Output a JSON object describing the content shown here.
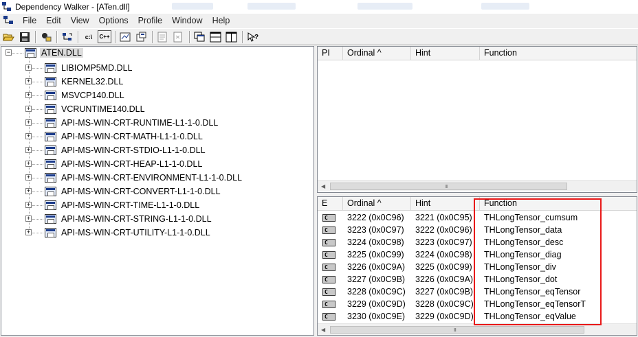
{
  "window": {
    "title": "Dependency Walker - [ATen.dll]"
  },
  "menu": [
    "File",
    "Edit",
    "View",
    "Options",
    "Profile",
    "Window",
    "Help"
  ],
  "toolbar": {
    "buttons": [
      {
        "name": "open-icon"
      },
      {
        "name": "save-icon"
      },
      {
        "name": "copy-icon"
      },
      {
        "name": "refresh-icon"
      },
      {
        "name": "full-paths-label",
        "label": "c:\\"
      },
      {
        "name": "undecorate-cpp-label",
        "label": "C++"
      },
      {
        "name": "auto-expand-icon"
      },
      {
        "name": "properties-icon"
      },
      {
        "name": "system-info-icon"
      },
      {
        "name": "find-icon"
      },
      {
        "name": "configure-paths-icon"
      },
      {
        "name": "module-list-icon"
      },
      {
        "name": "cascade-icon"
      },
      {
        "name": "tile-horizontal-icon"
      },
      {
        "name": "tile-vertical-icon"
      },
      {
        "name": "help-icon"
      }
    ]
  },
  "tree": {
    "root": "ATEN.DLL",
    "children": [
      "LIBIOMP5MD.DLL",
      "KERNEL32.DLL",
      "MSVCP140.DLL",
      "VCRUNTIME140.DLL",
      "API-MS-WIN-CRT-RUNTIME-L1-1-0.DLL",
      "API-MS-WIN-CRT-MATH-L1-1-0.DLL",
      "API-MS-WIN-CRT-STDIO-L1-1-0.DLL",
      "API-MS-WIN-CRT-HEAP-L1-1-0.DLL",
      "API-MS-WIN-CRT-ENVIRONMENT-L1-1-0.DLL",
      "API-MS-WIN-CRT-CONVERT-L1-1-0.DLL",
      "API-MS-WIN-CRT-TIME-L1-1-0.DLL",
      "API-MS-WIN-CRT-STRING-L1-1-0.DLL",
      "API-MS-WIN-CRT-UTILITY-L1-1-0.DLL"
    ]
  },
  "imports_pane": {
    "columns": [
      "PI",
      "Ordinal ^",
      "Hint",
      "Function"
    ]
  },
  "exports_pane": {
    "columns": [
      "E",
      "Ordinal ^",
      "Hint",
      "Function"
    ],
    "rows": [
      {
        "e": "C",
        "ordinal": "3222 (0x0C96)",
        "hint": "3221 (0x0C95)",
        "function": "THLongTensor_cumsum"
      },
      {
        "e": "C",
        "ordinal": "3223 (0x0C97)",
        "hint": "3222 (0x0C96)",
        "function": "THLongTensor_data"
      },
      {
        "e": "C",
        "ordinal": "3224 (0x0C98)",
        "hint": "3223 (0x0C97)",
        "function": "THLongTensor_desc"
      },
      {
        "e": "C",
        "ordinal": "3225 (0x0C99)",
        "hint": "3224 (0x0C98)",
        "function": "THLongTensor_diag"
      },
      {
        "e": "C",
        "ordinal": "3226 (0x0C9A)",
        "hint": "3225 (0x0C99)",
        "function": "THLongTensor_div"
      },
      {
        "e": "C",
        "ordinal": "3227 (0x0C9B)",
        "hint": "3226 (0x0C9A)",
        "function": "THLongTensor_dot"
      },
      {
        "e": "C",
        "ordinal": "3228 (0x0C9C)",
        "hint": "3227 (0x0C9B)",
        "function": "THLongTensor_eqTensor"
      },
      {
        "e": "C",
        "ordinal": "3229 (0x0C9D)",
        "hint": "3228 (0x0C9C)",
        "function": "THLongTensor_eqTensorT"
      },
      {
        "e": "C",
        "ordinal": "3230 (0x0C9E)",
        "hint": "3229 (0x0C9D)",
        "function": "THLongTensor_eqValue"
      }
    ]
  },
  "scrollbar_grip": "III",
  "colors": {
    "annotation": "#e81818",
    "selection": "#dcdcdc",
    "window_bg": "#f0f0f0"
  }
}
